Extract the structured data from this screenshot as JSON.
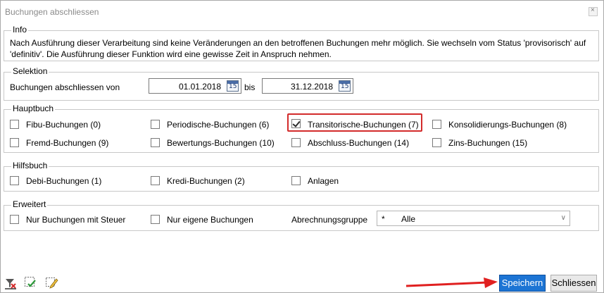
{
  "window": {
    "title": "Buchungen abschliessen",
    "close_glyph": "×"
  },
  "info": {
    "legend": "Info",
    "text": "Nach Ausführung dieser Verarbeitung sind keine Veränderungen an den betroffenen Buchungen mehr möglich. Sie wechseln vom Status 'provisorisch' auf 'definitiv'. Die Ausführung dieser Funktion wird eine gewisse Zeit in Anspruch nehmen."
  },
  "selektion": {
    "legend": "Selektion",
    "label_from": "Buchungen abschliessen von",
    "date_from": "01.01.2018",
    "label_to": "bis",
    "date_to": "31.12.2018",
    "calendar_number": "15"
  },
  "hauptbuch": {
    "legend": "Hauptbuch",
    "items": [
      {
        "label": "Fibu-Buchungen (0)",
        "checked": false
      },
      {
        "label": "Periodische-Buchungen (6)",
        "checked": false
      },
      {
        "label": "Transitorische-Buchungen (7)",
        "checked": true
      },
      {
        "label": "Konsolidierungs-Buchungen (8)",
        "checked": false
      },
      {
        "label": "Fremd-Buchungen (9)",
        "checked": false
      },
      {
        "label": "Bewertungs-Buchungen (10)",
        "checked": false
      },
      {
        "label": "Abschluss-Buchungen (14)",
        "checked": false
      },
      {
        "label": "Zins-Buchungen (15)",
        "checked": false
      }
    ]
  },
  "hilfsbuch": {
    "legend": "Hilfsbuch",
    "items": [
      {
        "label": "Debi-Buchungen (1)",
        "checked": false
      },
      {
        "label": "Kredi-Buchungen (2)",
        "checked": false
      },
      {
        "label": "Anlagen",
        "checked": false
      }
    ]
  },
  "erweitert": {
    "legend": "Erweitert",
    "items": [
      {
        "label": "Nur Buchungen mit Steuer",
        "checked": false
      },
      {
        "label": "Nur eigene Buchungen",
        "checked": false
      }
    ],
    "group_label": "Abrechnungsgruppe",
    "group_code": "*",
    "group_value": "Alle"
  },
  "footer": {
    "save_label": "Speichern",
    "close_label": "Schliessen"
  },
  "colors": {
    "primary_button": "#1c74d4",
    "highlight": "#d32b2b",
    "arrow": "#e02020"
  }
}
